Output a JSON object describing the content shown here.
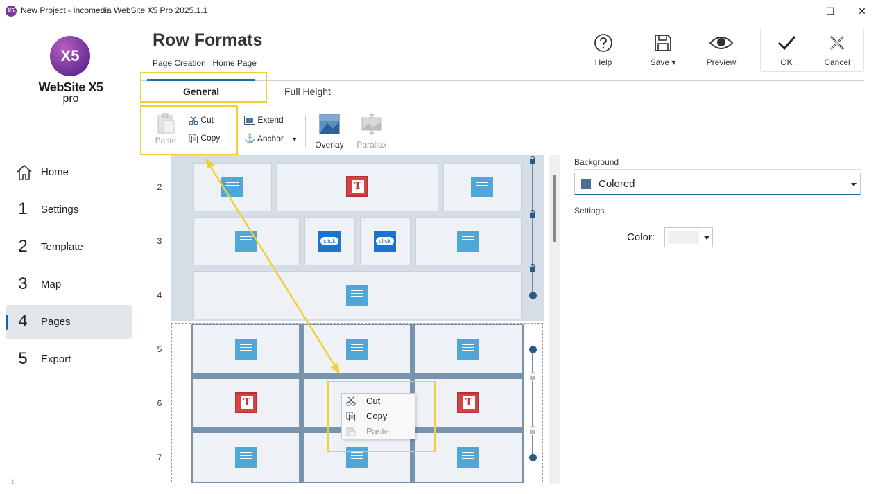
{
  "window": {
    "app_icon_text": "X5",
    "title": "New Project - Incomedia WebSite X5 Pro 2025.1.1",
    "minimize": "—",
    "maximize": "☐",
    "close": "✕"
  },
  "logo": {
    "text": "WebSite X5",
    "sub": "pro",
    "badge": "X5"
  },
  "nav": {
    "items": [
      {
        "num": "",
        "label": "Home"
      },
      {
        "num": "1",
        "label": "Settings"
      },
      {
        "num": "2",
        "label": "Template"
      },
      {
        "num": "3",
        "label": "Map"
      },
      {
        "num": "4",
        "label": "Pages"
      },
      {
        "num": "5",
        "label": "Export"
      }
    ],
    "active": "Pages"
  },
  "header": {
    "title": "Row Formats",
    "breadcrumb": "Page Creation | Home Page",
    "help": "Help",
    "save": "Save",
    "preview": "Preview",
    "ok": "OK",
    "cancel": "Cancel"
  },
  "tabs": [
    {
      "label": "General",
      "active": true
    },
    {
      "label": "Full Height",
      "active": false
    }
  ],
  "ribbon": {
    "paste": "Paste",
    "cut": "Cut",
    "copy": "Copy",
    "extend": "Extend",
    "anchor": "Anchor",
    "overlay": "Overlay",
    "parallax": "Parallax"
  },
  "grid": {
    "row_numbers": [
      "2",
      "3",
      "4",
      "5",
      "6",
      "7"
    ],
    "click_label": "click",
    "title_glyph": "T"
  },
  "context_menu": {
    "items": [
      {
        "label": "Cut",
        "enabled": true
      },
      {
        "label": "Copy",
        "enabled": true
      },
      {
        "label": "Paste",
        "enabled": false
      }
    ]
  },
  "right_panel": {
    "background_label": "Background",
    "background_value": "Colored",
    "background_swatch": "#4a6f94",
    "settings_label": "Settings",
    "color_label": "Color:",
    "color_value": "#f0f0f0"
  },
  "colors": {
    "accent": "#1d6ea5",
    "highlight": "#f2cf36",
    "text_object": "#4ea7d4",
    "title_object": "#d24444",
    "button_object": "#1c75c9"
  }
}
